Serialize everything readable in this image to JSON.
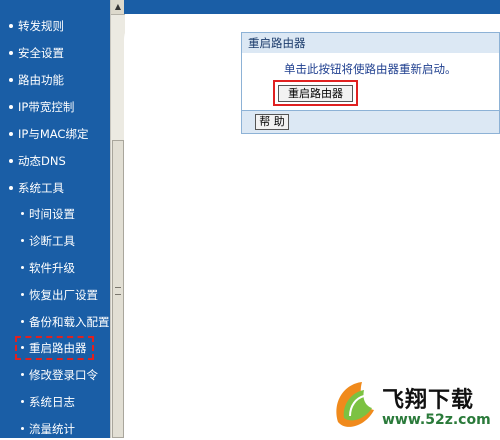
{
  "sidebar": {
    "items": [
      {
        "label": "转发规则",
        "level": "top"
      },
      {
        "label": "安全设置",
        "level": "top"
      },
      {
        "label": "路由功能",
        "level": "top"
      },
      {
        "label": "IP带宽控制",
        "level": "top"
      },
      {
        "label": "IP与MAC绑定",
        "level": "top"
      },
      {
        "label": "动态DNS",
        "level": "top"
      },
      {
        "label": "系统工具",
        "level": "top"
      },
      {
        "label": "时间设置",
        "level": "sub"
      },
      {
        "label": "诊断工具",
        "level": "sub"
      },
      {
        "label": "软件升级",
        "level": "sub"
      },
      {
        "label": "恢复出厂设置",
        "level": "sub"
      },
      {
        "label": "备份和载入配置",
        "level": "sub"
      },
      {
        "label": "重启路由器",
        "level": "sub",
        "selected": true
      },
      {
        "label": "修改登录口令",
        "level": "sub"
      },
      {
        "label": "系统日志",
        "level": "sub"
      },
      {
        "label": "流量统计",
        "level": "sub"
      }
    ]
  },
  "panel": {
    "title": "重启路由器",
    "message": "单击此按钮将使路由器重新启动。",
    "reboot_button_label": "重启路由器",
    "help_button_label": "帮 助"
  },
  "watermark": {
    "title": "飞翔下载",
    "url": "www.52z.com"
  },
  "colors": {
    "sidebar_bg": "#1a5ea6",
    "highlight_red": "#e02020",
    "panel_header": "#dce8f4"
  }
}
